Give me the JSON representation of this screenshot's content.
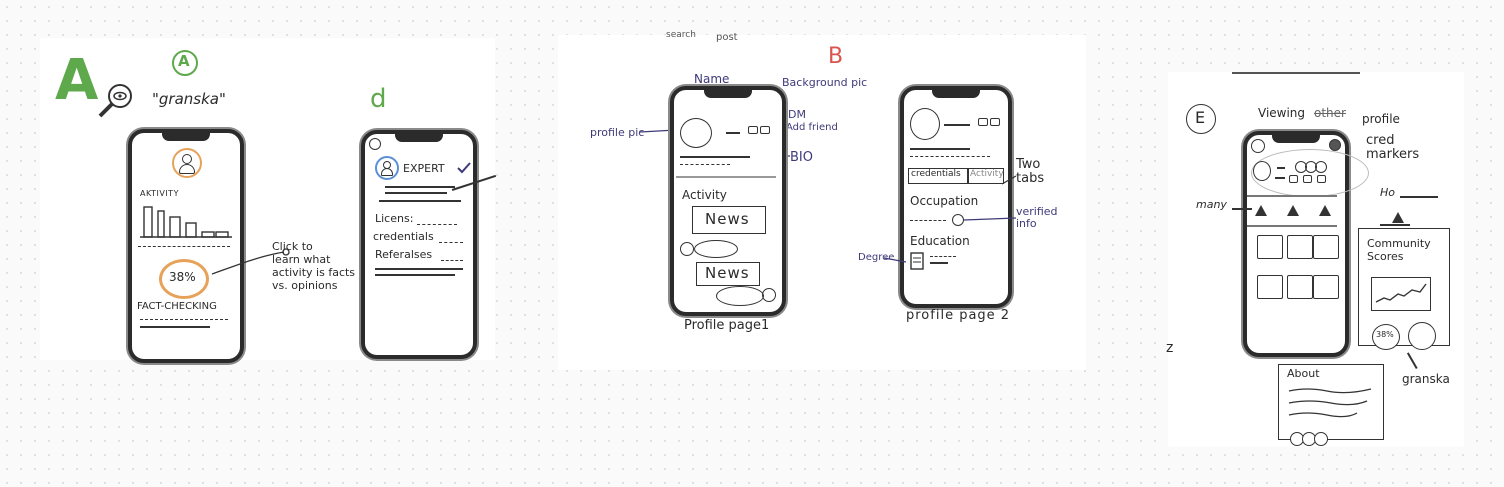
{
  "sketch_a": {
    "label": "A",
    "badge": "A",
    "app_name": "\"granska\"",
    "activity_label": "AKTIVITY",
    "percent": "38%",
    "fact_checking": "FACT-CHECKING",
    "annotation": [
      "Click to",
      "learn what",
      "activity is facts",
      "vs. opinions"
    ]
  },
  "sketch_d": {
    "label": "d",
    "expert": "EXPERT",
    "licens": "Licens:",
    "credentials": "credentials",
    "referalses": "Referalses"
  },
  "sketch_b": {
    "label": "B",
    "top_search": "search",
    "top_post": "post",
    "name": "Name",
    "background_pic": "Background pic",
    "profile_pic": "profile pic",
    "dm": "DM",
    "add_friend": "Add friend",
    "bio": "BIO",
    "activity": "Activity",
    "news": "News",
    "news2": "News",
    "caption1": "Profile page1",
    "two_tabs": [
      "Two",
      "tabs"
    ],
    "tab1": "credentials",
    "tab2": "Activity",
    "occupation": "Occupation",
    "verified": [
      "verified",
      "info"
    ],
    "education": "Education",
    "degree": "Degree",
    "caption2": "profile page 2"
  },
  "sketch_e": {
    "label": "E",
    "viewing": "Viewing other profile",
    "viewing_struck": "other",
    "viewing_pre": "Viewing",
    "viewing_post": "profile",
    "cred_markers": [
      "cred",
      "markers"
    ],
    "left_note": "many",
    "right_note": "Ho",
    "community": [
      "Community",
      "Scores"
    ],
    "small_percent": "38%",
    "granska": "granska",
    "about": "About",
    "stray_mark": "z"
  },
  "colors": {
    "ink": "#2b2b2b",
    "green_marker": "#5fa94d",
    "purple_pen": "#3e3a7a",
    "orange_ring": "#e7a25a"
  }
}
